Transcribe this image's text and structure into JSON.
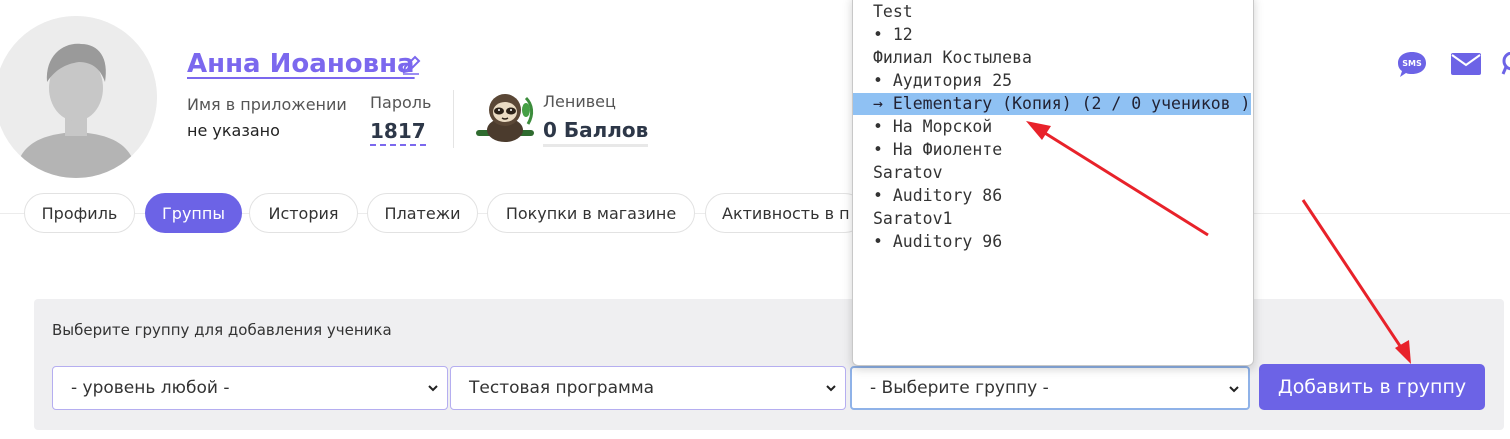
{
  "student": {
    "name": "Анна Иоановна",
    "app_name_label": "Имя в приложении",
    "app_name_value": "не указано",
    "password_label": "Пароль",
    "password_value": "1817",
    "rank_label": "Ленивец",
    "points_value": "0 Баллов"
  },
  "header_icons": [
    "sms-icon",
    "email-icon"
  ],
  "tabs": [
    {
      "label": "Профиль",
      "active": false
    },
    {
      "label": "Группы",
      "active": true
    },
    {
      "label": "История",
      "active": false
    },
    {
      "label": "Платежи",
      "active": false
    },
    {
      "label": "Покупки в магазине",
      "active": false
    },
    {
      "label": "Активность в п",
      "active": false
    }
  ],
  "group_form": {
    "title": "Выберите группу для добавления ученика",
    "level_select": "- уровень любой -",
    "program_select": "Тестовая программа",
    "group_select": "- Выберите группу -",
    "add_button": "Добавить в группу"
  },
  "group_dropdown": {
    "options": [
      {
        "label": "Test",
        "highlighted": false
      },
      {
        "label": "• 12",
        "highlighted": false
      },
      {
        "label": "Филиал Костылева",
        "highlighted": false
      },
      {
        "label": "• Аудитория 25",
        "highlighted": false
      },
      {
        "label": "→ Elementary (Копия) (2 / 0 учеников )",
        "highlighted": true
      },
      {
        "label": "• На Морской",
        "highlighted": false
      },
      {
        "label": "• На Фиоленте",
        "highlighted": false
      },
      {
        "label": "Saratov",
        "highlighted": false
      },
      {
        "label": "• Auditory 86",
        "highlighted": false
      },
      {
        "label": "Saratov1",
        "highlighted": false
      },
      {
        "label": "• Auditory 96",
        "highlighted": false
      }
    ]
  },
  "colors": {
    "accent": "#6c63e6",
    "name_link": "#7b68ee",
    "highlight": "#8fc1f3",
    "annotation_arrow": "#e8222a"
  }
}
